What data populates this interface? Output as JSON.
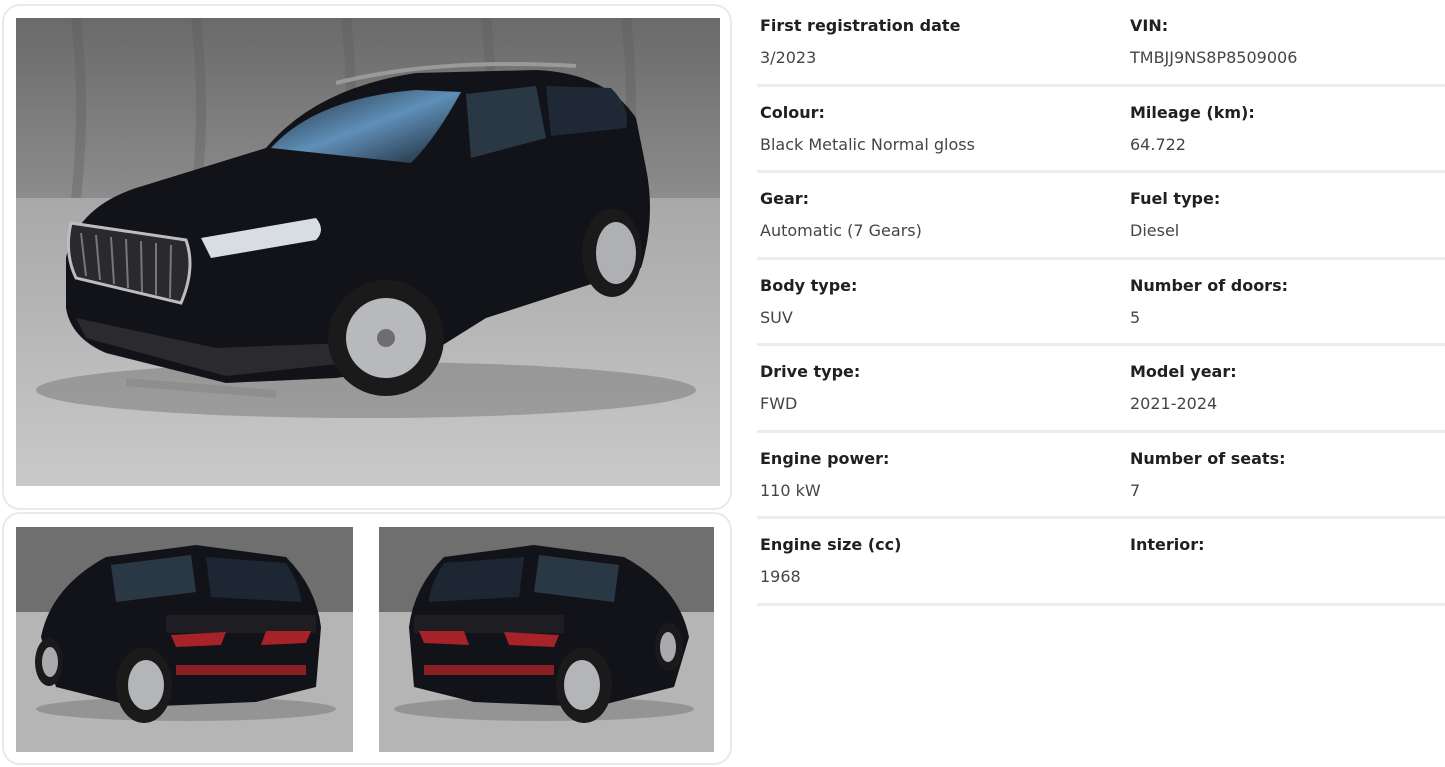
{
  "gallery": {
    "main_photo": "car-front-left-photo",
    "thumbnails": [
      "car-rear-left-photo",
      "car-rear-right-photo"
    ]
  },
  "specs": {
    "first_registration": {
      "label": "First registration date",
      "value": "3/2023"
    },
    "vin": {
      "label": "VIN:",
      "value": "TMBJJ9NS8P8509006"
    },
    "colour": {
      "label": "Colour:",
      "value": "Black Metalic Normal gloss"
    },
    "mileage": {
      "label": "Mileage (km):",
      "value": "64.722"
    },
    "gear": {
      "label": "Gear:",
      "value": "Automatic (7 Gears)"
    },
    "fuel_type": {
      "label": "Fuel type:",
      "value": "Diesel"
    },
    "body_type": {
      "label": "Body type:",
      "value": "SUV"
    },
    "doors": {
      "label": "Number of doors:",
      "value": "5"
    },
    "drive_type": {
      "label": "Drive type:",
      "value": "FWD"
    },
    "model_year": {
      "label": "Model year:",
      "value": "2021-2024"
    },
    "engine_power": {
      "label": "Engine power:",
      "value": "110 kW"
    },
    "seats": {
      "label": "Number of seats:",
      "value": "7"
    },
    "engine_size": {
      "label": "Engine size (cc)",
      "value": "1968"
    },
    "interior": {
      "label": "Interior:",
      "value": ""
    }
  }
}
